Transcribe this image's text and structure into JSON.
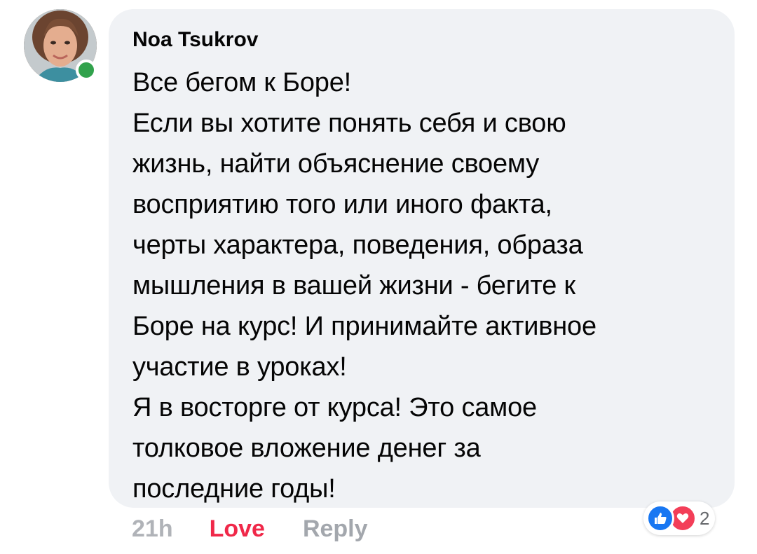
{
  "comment": {
    "author": "Noa Tsukrov",
    "text": "Все бегом к Боре!\nЕсли вы хотите понять себя и свою\nжизнь, найти объяснение своему\nвосприятию того или иного факта,\nчерты характера, поведения, образа\nмышления в вашей жизни - бегите к\nБоре на курс! И принимайте активное\nучастие в уроках!\nЯ в восторге от курса! Это самое\nтолковое вложение денег за\nпоследние годы!",
    "timestamp": "21h",
    "love_label": "Love",
    "reply_label": "Reply",
    "reaction_count": "2",
    "reactions": [
      "like-icon",
      "love-icon"
    ],
    "online": true
  },
  "colors": {
    "bubble": "#f0f2f5",
    "love": "#f02849",
    "like": "#1877f2",
    "heart": "#f33e58",
    "online": "#31a24c"
  }
}
